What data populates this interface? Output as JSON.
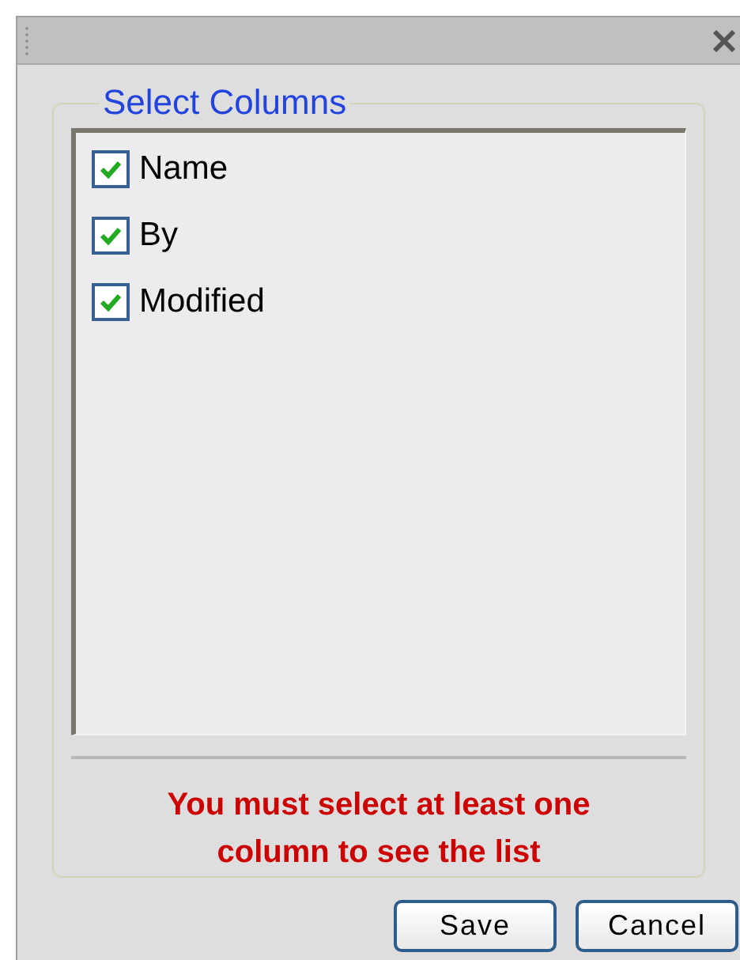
{
  "dialog": {
    "legend": "Select Columns",
    "columns": [
      {
        "label": "Name",
        "checked": true
      },
      {
        "label": "By",
        "checked": true
      },
      {
        "label": "Modified",
        "checked": true
      }
    ],
    "message": "You must select at least one column to see the list",
    "buttons": [
      "Save",
      "Cancel"
    ]
  }
}
